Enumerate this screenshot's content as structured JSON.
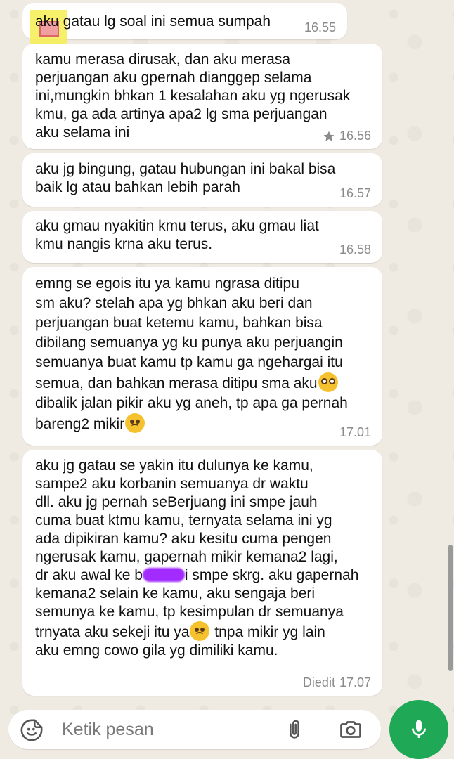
{
  "messages": [
    {
      "text": "aku gatau lg soal ini semua sumpah",
      "time": "16.55"
    },
    {
      "text": "kamu merasa dirusak, dan aku merasa\nperjuangan aku gpernah dianggep selama\nini,mungkin bhkan 1 kesalahan aku yg ngerusak\nkmu, ga ada artinya apa2 lg sma perjuangan\naku selama ini",
      "time": "16.56",
      "starred": true
    },
    {
      "text": "aku jg bingung, gatau hubungan ini bakal bisa\nbaik lg atau bahkan lebih parah",
      "time": "16.57"
    },
    {
      "text": "aku gmau nyakitin kmu terus, aku gmau liat\nkmu nangis krna aku terus.",
      "time": "16.58"
    },
    {
      "text_a": "emng se egois itu ya kamu ngrasa ditipu\nsm aku? stelah apa yg bhkan aku beri dan\nperjuangan buat ketemu kamu, bahkan bisa\ndibilang semuanya yg ku punya aku perjuangin\nsemuanya buat kamu tp kamu ga ngehargai itu\nsemua, dan bahkan merasa ditipu sma aku",
      "emoji_a": "pleading-face",
      "text_b": "dibalik jalan pikir aku yg aneh, tp apa ga pernah\nbareng2 mikir",
      "emoji_b": "sad-face",
      "time": "17.01"
    },
    {
      "text_a": "aku jg gatau se yakin itu dulunya ke kamu,\nsampe2 aku korbanin semuanya dr waktu\ndll. aku jg pernah seBerjuang ini smpe jauh\ncuma buat ktmu kamu, ternyata selama ini yg\nada dipikiran kamu? aku kesitu cuma pengen\nngerusak kamu, gapernah mikir kemana2 lagi,",
      "line7_pre": "dr aku awal ke b",
      "line7_post": "i smpe skrg. aku gapernah",
      "text_b": "kemana2 selain ke kamu, aku sengaja beri\nsemunya ke kamu, tp kesimpulan dr semuanya",
      "line10_pre": "trnyata aku sekeji itu ya",
      "emoji_c": "sad-face",
      "line10_post": " tnpa mikir yg lain",
      "line11": "aku emng cowo gila yg dimiliki kamu.",
      "edited_label": "Diedit",
      "time": "17.07"
    }
  ],
  "composer": {
    "placeholder": "Ketik pesan"
  },
  "icons": [
    "sticker-icon",
    "attach-icon",
    "camera-icon",
    "mic-icon",
    "star-icon"
  ],
  "colors": {
    "bubble": "#ffffff",
    "background": "#efeae2",
    "send": "#1fa855",
    "timestamp": "#8a8a8a"
  }
}
